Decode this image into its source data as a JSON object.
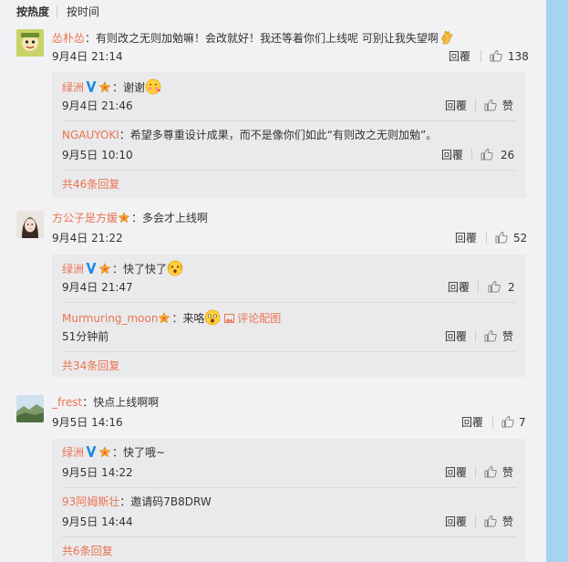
{
  "sort": {
    "hot": "按热度",
    "time": "按时间"
  },
  "actions": {
    "reply": "回覆"
  },
  "colors": {
    "link": "#eb7350",
    "background": "#f2f2f5",
    "subbox": "#eaeaec",
    "side_strip": "#a6d4f0"
  },
  "icons": {
    "like": "thumbs-up-icon",
    "verified": "verified-v-icon",
    "vip": "vip-badge-icon"
  },
  "comments": [
    {
      "user": "怂朴怂",
      "text": "：有则改之无则加勉嘛！会改就好！我还等着你们上线呢 可别让我失望啊",
      "time": "9月4日 21:14",
      "likes": "138",
      "replies": [
        {
          "user": "绿洲",
          "text": "：谢谢",
          "time": "9月4日 21:46",
          "likes": "赞"
        },
        {
          "user": "NGAUYOKI",
          "text": "：希望多尊重设计成果，而不是像你们如此“有则改之无则加勉”。",
          "time": "9月5日 10:10",
          "likes": "26"
        }
      ],
      "more": "共46条回复"
    },
    {
      "user": "方公子是方媛",
      "text": "：多会才上线啊",
      "time": "9月4日 21:22",
      "likes": "52",
      "replies": [
        {
          "user": "绿洲",
          "text": "：快了快了",
          "time": "9月4日 21:47",
          "likes": "2"
        },
        {
          "user": "Murmuring_moon",
          "text": "：来咯",
          "pic": "评论配图",
          "time": "51分钟前",
          "likes": "赞"
        }
      ],
      "more": "共34条回复"
    },
    {
      "user": "_frest",
      "text": "：快点上线啊啊",
      "time": "9月5日 14:16",
      "likes": "7",
      "replies": [
        {
          "user": "绿洲",
          "text": "：快了哦~",
          "time": "9月5日 14:22",
          "likes": "赞"
        },
        {
          "user": "93阿姆斯壮",
          "text": "：邀请码7B8DRW",
          "time": "9月5日 14:44",
          "likes": "赞"
        }
      ],
      "more": "共6条回复"
    }
  ]
}
